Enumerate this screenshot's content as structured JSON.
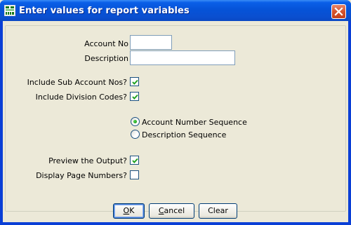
{
  "window": {
    "title": "Enter values for report variables",
    "title_icon": "report-grid-icon",
    "close_icon": "close-icon",
    "titlebar_color": "#0653d8",
    "close_color": "#d5532c",
    "background": "#ece9d8"
  },
  "form": {
    "account_no": {
      "label": "Account No",
      "value": ""
    },
    "description": {
      "label": "Description",
      "value": ""
    },
    "include_sub": {
      "label": "Include Sub Account Nos?",
      "checked": true
    },
    "include_div": {
      "label": "Include Division Codes?",
      "checked": true
    },
    "sequence": {
      "options": [
        {
          "label": "Account Number Sequence",
          "selected": true
        },
        {
          "label": "Description Sequence",
          "selected": false
        }
      ]
    },
    "preview": {
      "label": "Preview the Output?",
      "checked": true
    },
    "page_numbers": {
      "label": "Display Page Numbers?",
      "checked": false
    }
  },
  "buttons": {
    "ok": {
      "underline": "O",
      "rest": "K"
    },
    "cancel": {
      "underline": "C",
      "rest": "ancel"
    },
    "clear": {
      "label": "Clear"
    }
  }
}
